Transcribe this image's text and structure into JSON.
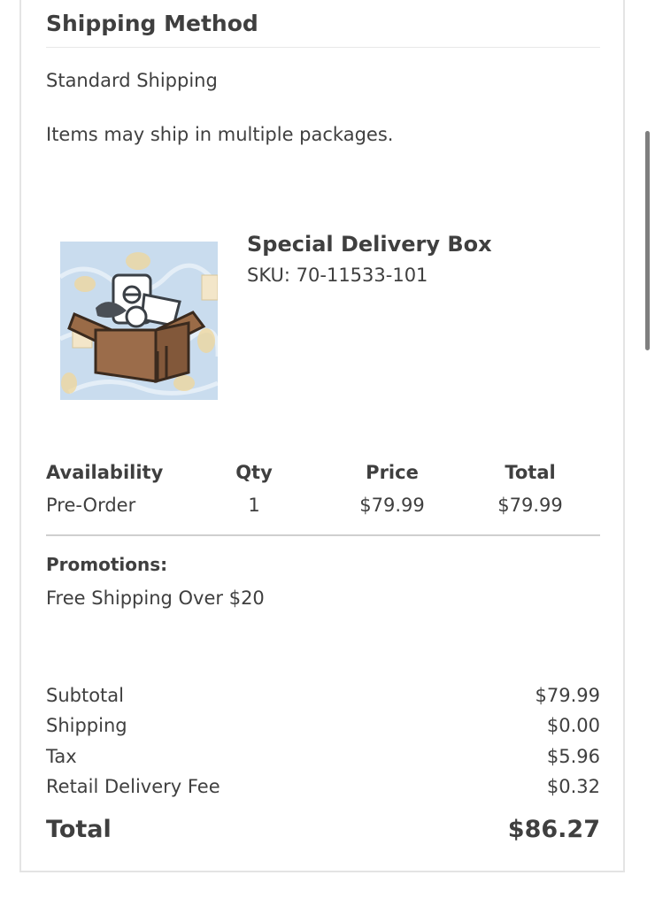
{
  "shipping": {
    "title": "Shipping Method",
    "method": "Standard Shipping",
    "note": "Items may ship in multiple packages."
  },
  "product": {
    "name": "Special Delivery Box",
    "sku": "SKU: 70-11533-101",
    "image_icon": "cardboard-box-with-items-image"
  },
  "line_item": {
    "headers": {
      "availability": "Availability",
      "qty": "Qty",
      "price": "Price",
      "total": "Total"
    },
    "values": {
      "availability": "Pre-Order",
      "qty": "1",
      "price": "$79.99",
      "total": "$79.99"
    }
  },
  "promotions": {
    "title": "Promotions:",
    "items": [
      "Free Shipping Over $20"
    ]
  },
  "summary": {
    "rows": [
      {
        "label": "Subtotal",
        "value": "$79.99"
      },
      {
        "label": "Shipping",
        "value": "$0.00"
      },
      {
        "label": "Tax",
        "value": "$5.96"
      },
      {
        "label": "Retail Delivery Fee",
        "value": "$0.32"
      }
    ],
    "total_label": "Total",
    "total_value": "$86.27"
  },
  "colors": {
    "text": "#3f3f3f",
    "divider": "#cfcfcf",
    "card_border": "#e4e4e4",
    "image_bg": "#c9dcee"
  }
}
